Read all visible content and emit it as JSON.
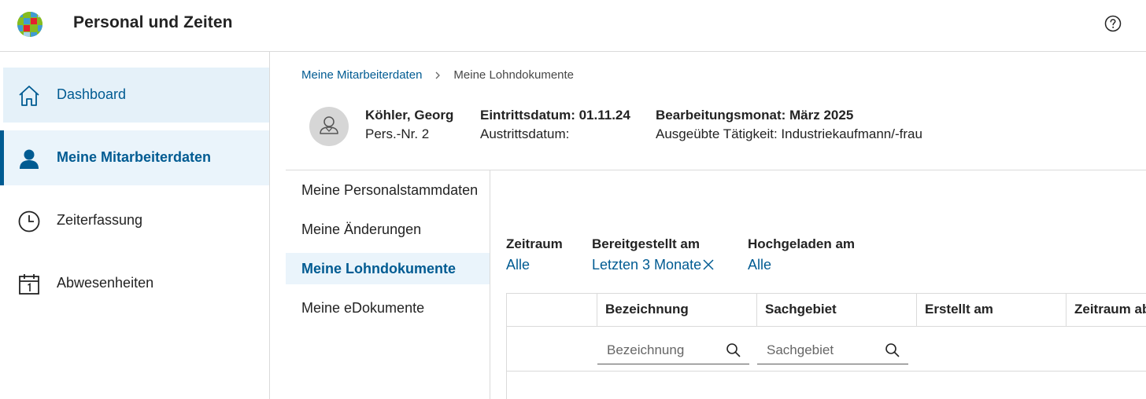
{
  "app": {
    "title": "Personal und Zeiten"
  },
  "sidebar": {
    "items": [
      {
        "label": "Dashboard",
        "icon": "home-icon"
      },
      {
        "label": "Meine Mitarbeiterdaten",
        "icon": "person-icon"
      },
      {
        "label": "Zeiterfassung",
        "icon": "clock-icon"
      },
      {
        "label": "Abwesenheiten",
        "icon": "calendar-icon"
      }
    ]
  },
  "breadcrumb": {
    "parent": "Meine Mitarbeiterdaten",
    "current": "Meine Lohndokumente"
  },
  "employee": {
    "name": "Köhler, Georg",
    "pers_nr": "Pers.-Nr. 2",
    "eintritt": "Eintrittsdatum: 01.11.24",
    "austritt": "Austrittsdatum:",
    "bearbeitungsmonat": "Bearbeitungsmonat: März 2025",
    "taetigkeit": "Ausgeübte Tätigkeit: Industriekaufmann/-frau"
  },
  "submenu": {
    "items": [
      {
        "label": "Meine Personalstammdaten"
      },
      {
        "label": "Meine Änderungen"
      },
      {
        "label": "Meine Lohndokumente"
      },
      {
        "label": "Meine eDokumente"
      }
    ]
  },
  "filters": {
    "zeitraum": {
      "label": "Zeitraum",
      "value": "Alle"
    },
    "bereitgestellt": {
      "label": "Bereitgestellt am",
      "value": "Letzten 3 Monate"
    },
    "hochgeladen": {
      "label": "Hochgeladen am",
      "value": "Alle"
    }
  },
  "table": {
    "columns": [
      "",
      "Bezeichnung",
      "Sachgebiet",
      "Erstellt am",
      "Zeitraum ab"
    ],
    "search": {
      "bezeichnung_placeholder": "Bezeichnung",
      "sachgebiet_placeholder": "Sachgebiet"
    }
  },
  "colors": {
    "accent": "#005b92",
    "active_bg": "#eaf4fb",
    "border": "#dadada"
  }
}
